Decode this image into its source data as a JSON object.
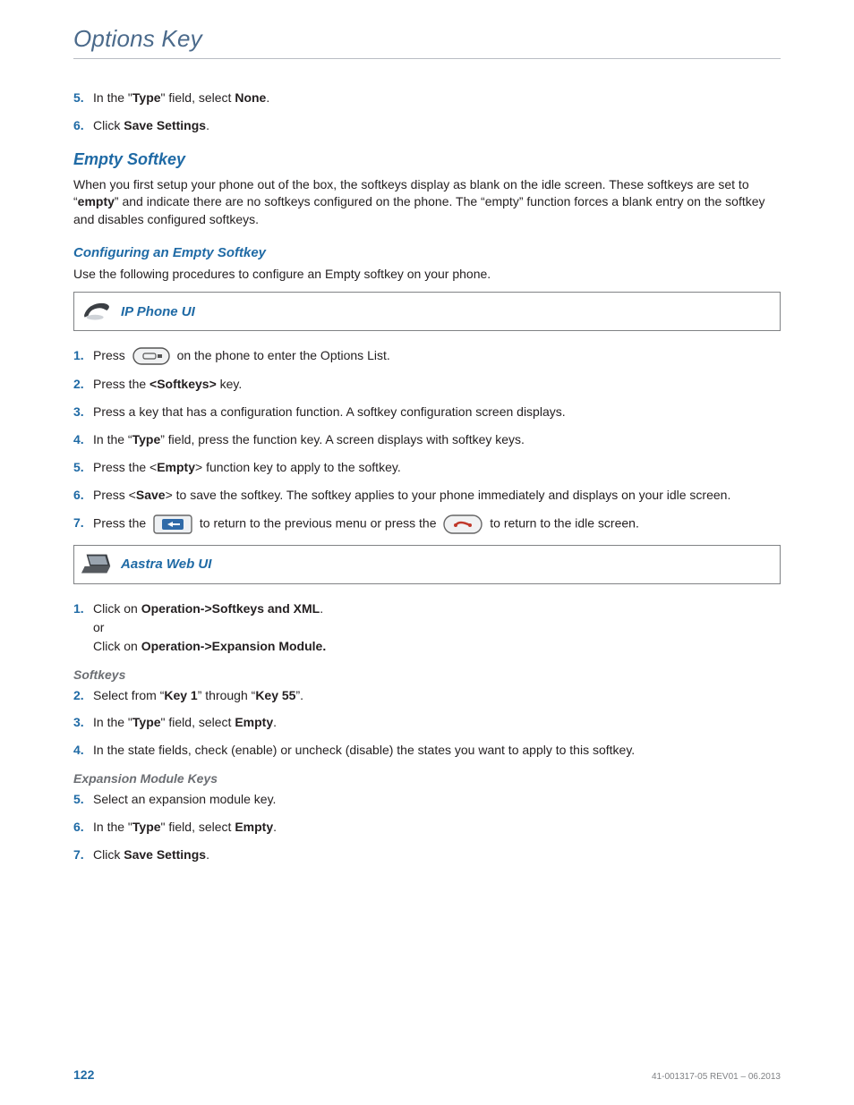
{
  "header": {
    "title": "Options Key"
  },
  "topSteps": {
    "s5": {
      "num": "5.",
      "pre": "In the \"",
      "b1": "Type",
      "mid": "\" field, select ",
      "b2": "None",
      "post": "."
    },
    "s6": {
      "num": "6.",
      "pre": "Click ",
      "b1": "Save Settings",
      "post": "."
    }
  },
  "section1": {
    "heading": "Empty Softkey",
    "para_pre": "When you first setup your phone out of the box, the softkeys display as blank on the idle screen. These softkeys are set to “",
    "para_b": "empty",
    "para_post": "” and indicate there are no softkeys configured on the phone. The “empty” function forces a blank entry on the softkey and disables configured softkeys.",
    "subheading": "Configuring an Empty Softkey",
    "subpara": "Use the following procedures to configure an Empty softkey on your phone."
  },
  "callout1": {
    "label": "IP Phone UI"
  },
  "phoneSteps": {
    "s1": {
      "num": "1.",
      "a": "Press ",
      "b": " on the phone to enter the Options List."
    },
    "s2": {
      "num": "2.",
      "a": "Press the ",
      "b1": "<Softkeys>",
      "c": " key."
    },
    "s3": {
      "num": "3.",
      "a": "Press a key that has a configuration function. A softkey configuration screen displays."
    },
    "s4": {
      "num": "4.",
      "a": "In the “",
      "b1": "Type",
      "c": "” field, press the function key. A screen displays with softkey keys."
    },
    "s5": {
      "num": "5.",
      "a": "Press the <",
      "b1": "Empty",
      "c": "> function key to apply to the softkey."
    },
    "s6": {
      "num": "6.",
      "a": "Press <",
      "b1": "Save",
      "c": "> to save the softkey. The softkey applies to your phone immediately and displays on your idle screen."
    },
    "s7": {
      "num": "7.",
      "a": "Press the ",
      "mid": " to return to the previous menu or press the ",
      "end": " to return to the idle screen."
    }
  },
  "callout2": {
    "label": "Aastra Web UI"
  },
  "webSteps": {
    "s1": {
      "num": "1.",
      "a": "Click on ",
      "b1": "Operation->Softkeys and XML",
      "or": "or",
      "a2": "Click on ",
      "b2": "Operation->Expansion Module."
    },
    "hSoft": "Softkeys",
    "s2": {
      "num": "2.",
      "a": "Select from “",
      "b1": "Key 1",
      "mid": "” through “",
      "b2": "Key 55",
      "end": "”."
    },
    "s3": {
      "num": "3.",
      "a": "In the \"",
      "b1": "Type",
      "mid": "\" field, select ",
      "b2": "Empty",
      "end": "."
    },
    "s4": {
      "num": "4.",
      "a": "In the state fields, check (enable) or uncheck (disable) the states you want to apply to this softkey."
    },
    "hExp": "Expansion Module Keys",
    "s5": {
      "num": "5.",
      "a": "Select an expansion module key."
    },
    "s6": {
      "num": "6.",
      "a": "In the \"",
      "b1": "Type",
      "mid": "\" field, select ",
      "b2": "Empty",
      "end": "."
    },
    "s7": {
      "num": "7.",
      "a": "Click ",
      "b1": "Save Settings",
      "end": "."
    }
  },
  "footer": {
    "pageNum": "122",
    "docRef": "41-001317-05 REV01 – 06.2013"
  }
}
